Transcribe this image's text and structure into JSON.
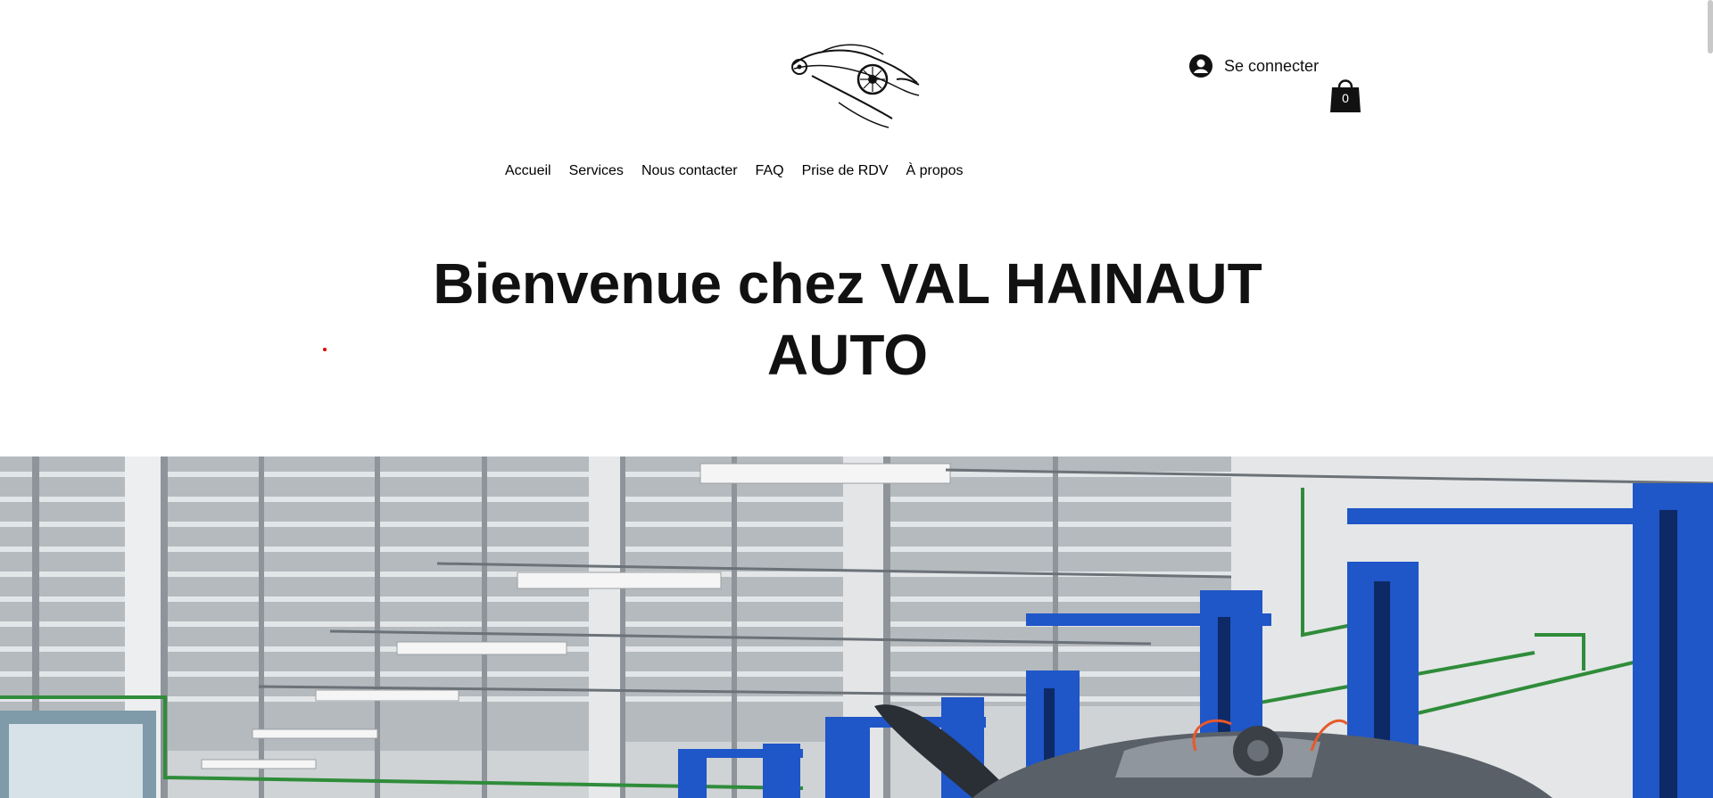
{
  "header": {
    "logo_icon": "sports-car-logo-icon",
    "login_label": "Se connecter",
    "login_icon": "user-avatar-icon",
    "cart_icon": "shopping-bag-icon",
    "cart_count": "0"
  },
  "nav": {
    "items": [
      {
        "label": "Accueil"
      },
      {
        "label": "Services"
      },
      {
        "label": "Nous contacter"
      },
      {
        "label": "FAQ"
      },
      {
        "label": "Prise de RDV"
      },
      {
        "label": "À propos"
      }
    ]
  },
  "hero": {
    "title_line1": "Bienvenue chez VAL HAINAUT",
    "title_line2": "AUTO",
    "image_subject": "garage with blue vehicle lifts",
    "accent_color": "#1f56c8"
  }
}
